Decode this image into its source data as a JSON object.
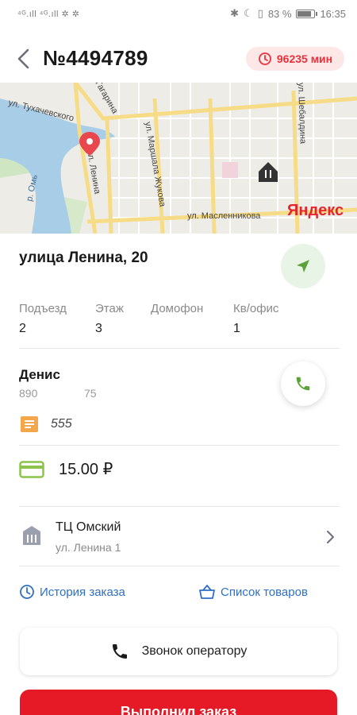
{
  "status_bar": {
    "left_icons": "⁴ᴳ.ıll ⁴ᴳ.ıll ✲ ✲",
    "battery": "83 %",
    "time": "16:35",
    "battery_level": 0.83
  },
  "header": {
    "order_number": "№4494789",
    "timer": "96235 мин"
  },
  "map": {
    "labels": {
      "street_tuhachevskogo": "ул. Тухачевского",
      "river": "р. Омь",
      "street_lenina": "ул. Ленина",
      "street_marshala_zhukova": "ул. Маршала Жукова",
      "street_masl": "ул. Масленникова",
      "street_shebaldina": "ул. Шебалдина",
      "street_gagarina": "Гагарина",
      "brand": "Яндекс"
    }
  },
  "address": "улица Ленина, 20",
  "info": [
    {
      "label": "Подъезд",
      "value": "2"
    },
    {
      "label": "Этаж",
      "value": "3"
    },
    {
      "label": "Домофон",
      "value": ""
    },
    {
      "label": "Кв/офис",
      "value": "1"
    }
  ],
  "contact": {
    "name": "Денис",
    "phone_part1": "890",
    "phone_part2": "75"
  },
  "comment": "555",
  "payment": {
    "amount": "15.00 ₽"
  },
  "store": {
    "name": "ТЦ Омский",
    "address": "ул. Ленина 1"
  },
  "links": {
    "history": "История заказа",
    "products": "Список товаров"
  },
  "buttons": {
    "call_operator": "Звонок оператору",
    "complete": "Выполнил заказ"
  },
  "colors": {
    "accent_red": "#e51a26",
    "link_blue": "#2f6fc4",
    "green": "#5aa339",
    "comment_orange": "#f3a64a"
  }
}
